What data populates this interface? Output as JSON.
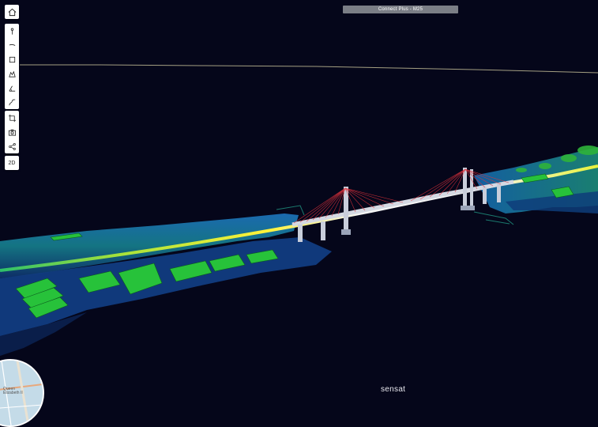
{
  "title_bar": {
    "text": "Connect Plus - M25"
  },
  "brand": {
    "name": "sensat"
  },
  "toolbar": {
    "home": {
      "icon": "home-icon"
    },
    "measure_tools": [
      {
        "name": "point-pin",
        "icon": "pin-icon"
      },
      {
        "name": "line",
        "icon": "line-icon"
      },
      {
        "name": "area",
        "icon": "area-icon"
      },
      {
        "name": "volume",
        "icon": "volume-icon"
      },
      {
        "name": "angle",
        "icon": "angle-icon"
      },
      {
        "name": "profile",
        "icon": "profile-icon"
      }
    ],
    "view_tools": [
      {
        "name": "crop",
        "icon": "crop-icon"
      },
      {
        "name": "camera",
        "icon": "camera-icon"
      },
      {
        "name": "share",
        "icon": "share-icon"
      }
    ],
    "view_mode_label": "2D"
  },
  "minimap": {
    "label": "Queen Elizabeth II"
  },
  "colors": {
    "background": "#05061a",
    "road": "#f2e43a",
    "terrain": "#1aa36a",
    "buildings": "#2fd33a",
    "bridge_deck": "#c8cdd8",
    "cables": "#e0323c"
  }
}
